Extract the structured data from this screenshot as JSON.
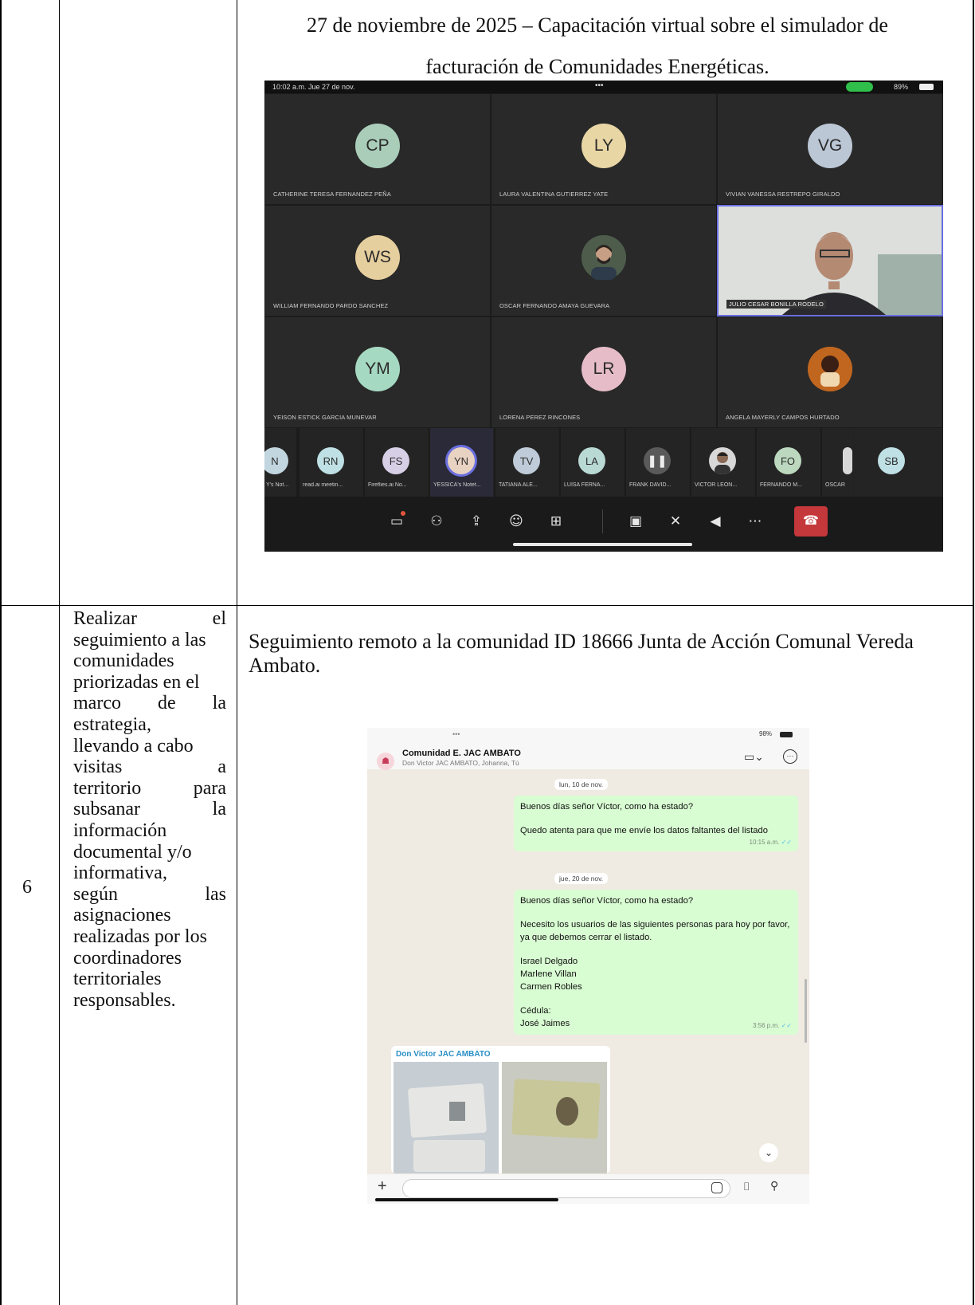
{
  "section_top": {
    "caption_line1": "27 de noviembre de 2025 – Capacitación virtual sobre el simulador de",
    "caption_line2": "facturación de Comunidades Energéticas."
  },
  "teams_call": {
    "status_time": "10:02 a.m.  Jue 27 de nov.",
    "status_dots": "•••",
    "battery": "89%",
    "tiles": [
      {
        "initials": "CP",
        "name": "CATHERINE TERESA FERNANDEZ PEÑA",
        "color": "#a9cdb9"
      },
      {
        "initials": "LY",
        "name": "LAURA VALENTINA GUTIERREZ YATE",
        "color": "#e9d6a5"
      },
      {
        "initials": "VG",
        "name": "VIVIAN VANESSA RESTREPO GIRALDO",
        "color": "#bcc7d6"
      },
      {
        "initials": "WS",
        "name": "WILLIAM FERNANDO PARDO SANCHEZ",
        "color": "#e6cf9e"
      },
      {
        "initials": "",
        "name": "OSCAR FERNANDO AMAYA GUEVARA",
        "color": "#5b6a5a"
      },
      {
        "initials": "",
        "name": "JULIO CESAR BONILLA RODELO",
        "color": "#c9ccc8"
      },
      {
        "initials": "YM",
        "name": "YEISON ESTICK GARCIA MUNEVAR",
        "color": "#a6d9c2"
      },
      {
        "initials": "LR",
        "name": "LORENA PEREZ RINCONES",
        "color": "#e5bcc8"
      },
      {
        "initials": "",
        "name": "ANGELA MAYERLY CAMPOS HURTADO",
        "color": "#b5591e"
      }
    ],
    "strip": [
      {
        "initials": "N",
        "name": "Y's Not...",
        "color": "#c2d6e0"
      },
      {
        "initials": "RN",
        "name": "read.ai meetin...",
        "color": "#bfe0e4"
      },
      {
        "initials": "FS",
        "name": "Fireflies.ai No...",
        "color": "#d7cfe6"
      },
      {
        "initials": "YN",
        "name": "YESSICA's Notet...",
        "color": "#e8d2c2"
      },
      {
        "initials": "TV",
        "name": "TATIANA ALE...",
        "color": "#bfcbd8"
      },
      {
        "initials": "LA",
        "name": "LUISA FERNA...",
        "color": "#b9d9d4"
      },
      {
        "initials": "",
        "name": "FRANK DAVID...",
        "color": "#e0e0e0"
      },
      {
        "initials": "",
        "name": "VICTOR LEON...",
        "color": "#d8d8d8"
      },
      {
        "initials": "FO",
        "name": "FERNANDO M...",
        "color": "#bcd9bf"
      },
      {
        "initials": "",
        "name": "OSCAR",
        "color": "#d8d8d8"
      },
      {
        "initials": "SB",
        "name": "",
        "color": "#bfe0e4"
      }
    ]
  },
  "row6": {
    "number": "6",
    "activity_lines": [
      "Realizar el",
      "seguimiento a las",
      "comunidades",
      "priorizadas en el",
      "marco de la",
      "estrategia,",
      "llevando a cabo",
      "visitas a",
      "territorio para",
      "subsanar la",
      "información",
      "documental y/o",
      "informativa,",
      "según las",
      "asignaciones",
      "realizadas por los",
      "coordinadores",
      "territoriales",
      "responsables."
    ],
    "caption": "Seguimiento remoto a la comunidad ID 18666 Junta de Acción Comunal Vereda Ambato."
  },
  "whatsapp": {
    "battery": "98%",
    "chat_title": "Comunidad E. JAC AMBATO",
    "chat_members": "Don Victor JAC AMBATO, Johanna, Tú",
    "date1": "lun, 10 de nov.",
    "msg1_line1": "Buenos días señor Víctor, como ha estado?",
    "msg1_line2": "Quedo atenta para que me envíe los datos faltantes del listado",
    "msg1_time": "10:15 a.m.",
    "date2": "jue, 20 de nov.",
    "msg2_line1": "Buenos días señor Víctor, como ha estado?",
    "msg2_line2": "Necesito los usuarios de las siguientes personas para hoy por favor, ya que debemos cerrar el listado.",
    "msg2_names": [
      "Israel Delgado",
      "Marlene Villan",
      "Carmen Robles"
    ],
    "msg2_cedula_label": "Cédula:",
    "msg2_cedula_name": "José Jaimes",
    "msg2_time": "3:56 p.m.",
    "sender_name": "Don Victor JAC AMBATO"
  }
}
